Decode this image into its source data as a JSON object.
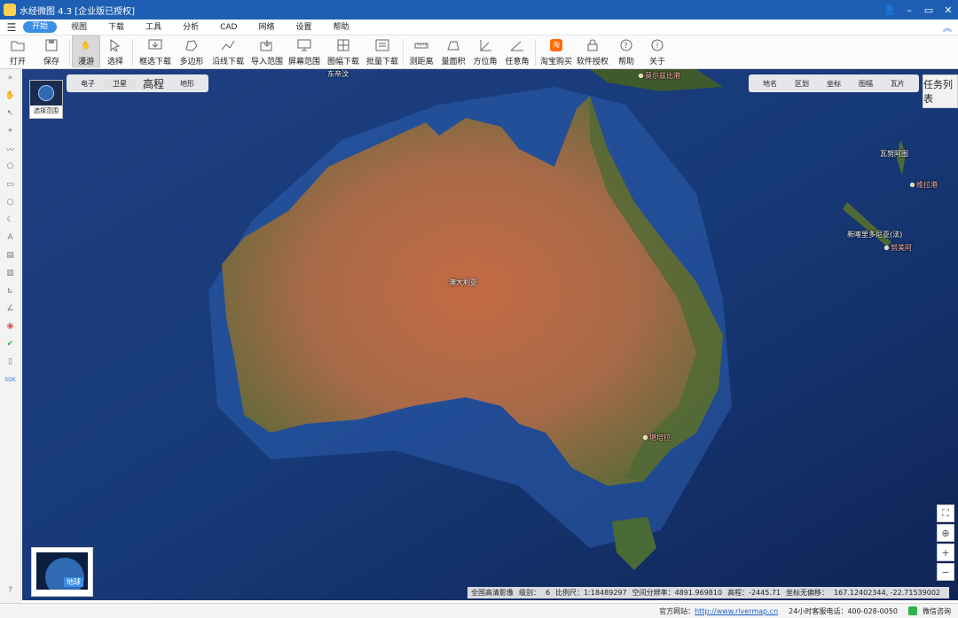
{
  "window": {
    "title": "水经微图 4.3 [企业版已授权]"
  },
  "menu": {
    "items": [
      "开始",
      "视图",
      "下载",
      "工具",
      "分析",
      "CAD",
      "网络",
      "设置",
      "帮助"
    ],
    "active_index": 0
  },
  "toolbar": {
    "buttons": [
      {
        "label": "打开",
        "icon": "folder-icon"
      },
      {
        "label": "保存",
        "icon": "save-icon"
      },
      {
        "label": "漫游",
        "icon": "hand-icon",
        "active": true
      },
      {
        "label": "选择",
        "icon": "pointer-icon"
      },
      {
        "label": "框选下载",
        "icon": "rect-download-icon"
      },
      {
        "label": "多边形",
        "icon": "polygon-icon"
      },
      {
        "label": "沿线下载",
        "icon": "line-download-icon"
      },
      {
        "label": "导入范围",
        "icon": "import-icon"
      },
      {
        "label": "屏幕范围",
        "icon": "screen-icon"
      },
      {
        "label": "图幅下载",
        "icon": "grid-icon"
      },
      {
        "label": "批量下载",
        "icon": "batch-icon"
      },
      {
        "label": "测距离",
        "icon": "ruler-icon"
      },
      {
        "label": "量面积",
        "icon": "area-icon"
      },
      {
        "label": "方位角",
        "icon": "azimuth-icon"
      },
      {
        "label": "任意角",
        "icon": "angle-icon"
      },
      {
        "label": "淘宝购买",
        "icon": "taobao-icon"
      },
      {
        "label": "软件授权",
        "icon": "lock-icon"
      },
      {
        "label": "帮助",
        "icon": "help-icon"
      },
      {
        "label": "关于",
        "icon": "info-icon"
      }
    ]
  },
  "map": {
    "type_tabs": [
      "电子",
      "卫星",
      "高程",
      "地形"
    ],
    "selected_type": "卫星",
    "layer_switch_label": "选择范围",
    "overlay_tabs": [
      "地名",
      "区划",
      "坐标",
      "图幅",
      "瓦片"
    ],
    "task_list": "任务列表",
    "labels": {
      "east_timor": "东帝汶",
      "port_moresby": "莫尔兹比港",
      "vanuatu": "瓦努阿图",
      "port_vila": "维拉港",
      "new_caledonia": "新喀里多尼亚(法)",
      "noumea": "努美阿",
      "australia": "澳大利亚",
      "canberra": "堪培拉"
    },
    "globe_label": "地球",
    "status": {
      "source": "全国高清影像",
      "level_label": "级别：",
      "level": "6",
      "scale_label": "比例尺：",
      "scale": "1:18489297",
      "resolution_label": "空间分辨率：",
      "resolution": "4891.969810",
      "elev_label": "高程：",
      "elev": "-2445.71",
      "offset_label": "坐标无偏移：",
      "coords": "167.12402344, -22.71539002"
    }
  },
  "footer": {
    "site_label": "官方网站：",
    "site_url": "http://www.rivermap.cn",
    "phone_label": "24小时客服电话：",
    "phone": "400-028-0050",
    "wechat": "微信咨询"
  },
  "colors": {
    "titlebar": "#1f5fb3",
    "accent": "#3a8ee6"
  }
}
